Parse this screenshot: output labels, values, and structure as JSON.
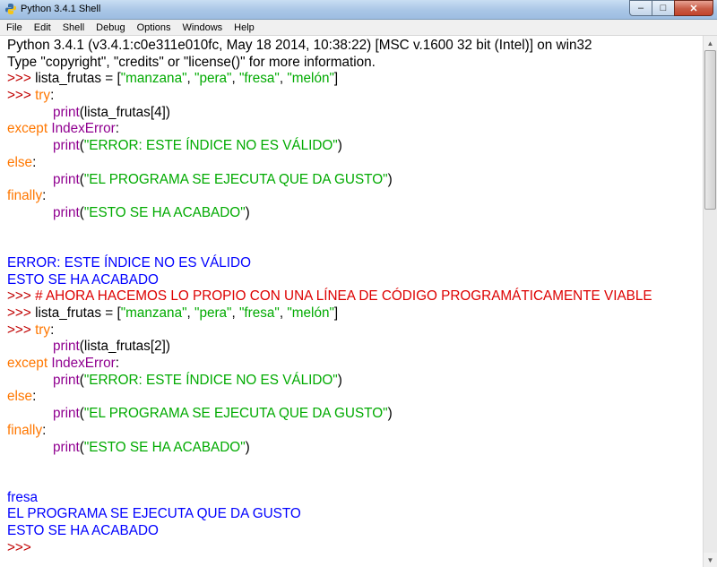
{
  "window": {
    "title": "Python 3.4.1 Shell"
  },
  "menubar": [
    "File",
    "Edit",
    "Shell",
    "Debug",
    "Options",
    "Windows",
    "Help"
  ],
  "window_controls": {
    "minimize_icon": "minimize-icon",
    "maximize_icon": "maximize-icon",
    "close_icon": "close-icon"
  },
  "colors": {
    "prompt": "#c00000",
    "keyword": "#ff7700",
    "builtin": "#900090",
    "string": "#00aa00",
    "output": "#0000ff",
    "comment": "#dd0000"
  },
  "lines": [
    [
      {
        "t": "default",
        "v": "Python 3.4.1 (v3.4.1:c0e311e010fc, May 18 2014, 10:38:22) [MSC v.1600 32 bit (Intel)] on win32"
      }
    ],
    [
      {
        "t": "default",
        "v": "Type \"copyright\", \"credits\" or \"license()\" for more information."
      }
    ],
    [
      {
        "t": "prompt",
        "v": ">>> "
      },
      {
        "t": "default",
        "v": "lista_frutas = ["
      },
      {
        "t": "string",
        "v": "\"manzana\""
      },
      {
        "t": "default",
        "v": ", "
      },
      {
        "t": "string",
        "v": "\"pera\""
      },
      {
        "t": "default",
        "v": ", "
      },
      {
        "t": "string",
        "v": "\"fresa\""
      },
      {
        "t": "default",
        "v": ", "
      },
      {
        "t": "string",
        "v": "\"melón\""
      },
      {
        "t": "default",
        "v": "]"
      }
    ],
    [
      {
        "t": "prompt",
        "v": ">>> "
      },
      {
        "t": "keyword",
        "v": "try"
      },
      {
        "t": "default",
        "v": ":"
      }
    ],
    [
      {
        "t": "default",
        "v": "            "
      },
      {
        "t": "builtin",
        "v": "print"
      },
      {
        "t": "default",
        "v": "(lista_frutas[4])"
      }
    ],
    [
      {
        "t": "keyword",
        "v": "except"
      },
      {
        "t": "default",
        "v": " "
      },
      {
        "t": "builtin",
        "v": "IndexError"
      },
      {
        "t": "default",
        "v": ":"
      }
    ],
    [
      {
        "t": "default",
        "v": "            "
      },
      {
        "t": "builtin",
        "v": "print"
      },
      {
        "t": "default",
        "v": "("
      },
      {
        "t": "string",
        "v": "\"ERROR: ESTE ÍNDICE NO ES VÁLIDO\""
      },
      {
        "t": "default",
        "v": ")"
      }
    ],
    [
      {
        "t": "keyword",
        "v": "else"
      },
      {
        "t": "default",
        "v": ":"
      }
    ],
    [
      {
        "t": "default",
        "v": "            "
      },
      {
        "t": "builtin",
        "v": "print"
      },
      {
        "t": "default",
        "v": "("
      },
      {
        "t": "string",
        "v": "\"EL PROGRAMA SE EJECUTA QUE DA GUSTO\""
      },
      {
        "t": "default",
        "v": ")"
      }
    ],
    [
      {
        "t": "keyword",
        "v": "finally"
      },
      {
        "t": "default",
        "v": ":"
      }
    ],
    [
      {
        "t": "default",
        "v": "            "
      },
      {
        "t": "builtin",
        "v": "print"
      },
      {
        "t": "default",
        "v": "("
      },
      {
        "t": "string",
        "v": "\"ESTO SE HA ACABADO\""
      },
      {
        "t": "default",
        "v": ")"
      }
    ],
    [],
    [],
    [
      {
        "t": "output",
        "v": "ERROR: ESTE ÍNDICE NO ES VÁLIDO"
      }
    ],
    [
      {
        "t": "output",
        "v": "ESTO SE HA ACABADO"
      }
    ],
    [
      {
        "t": "prompt",
        "v": ">>> "
      },
      {
        "t": "comment",
        "v": "# AHORA HACEMOS LO PROPIO CON UNA LÍNEA DE CÓDIGO PROGRAMÁTICAMENTE VIABLE"
      }
    ],
    [
      {
        "t": "prompt",
        "v": ">>> "
      },
      {
        "t": "default",
        "v": "lista_frutas = ["
      },
      {
        "t": "string",
        "v": "\"manzana\""
      },
      {
        "t": "default",
        "v": ", "
      },
      {
        "t": "string",
        "v": "\"pera\""
      },
      {
        "t": "default",
        "v": ", "
      },
      {
        "t": "string",
        "v": "\"fresa\""
      },
      {
        "t": "default",
        "v": ", "
      },
      {
        "t": "string",
        "v": "\"melón\""
      },
      {
        "t": "default",
        "v": "]"
      }
    ],
    [
      {
        "t": "prompt",
        "v": ">>> "
      },
      {
        "t": "keyword",
        "v": "try"
      },
      {
        "t": "default",
        "v": ":"
      }
    ],
    [
      {
        "t": "default",
        "v": "            "
      },
      {
        "t": "builtin",
        "v": "print"
      },
      {
        "t": "default",
        "v": "(lista_frutas[2])"
      }
    ],
    [
      {
        "t": "keyword",
        "v": "except"
      },
      {
        "t": "default",
        "v": " "
      },
      {
        "t": "builtin",
        "v": "IndexError"
      },
      {
        "t": "default",
        "v": ":"
      }
    ],
    [
      {
        "t": "default",
        "v": "            "
      },
      {
        "t": "builtin",
        "v": "print"
      },
      {
        "t": "default",
        "v": "("
      },
      {
        "t": "string",
        "v": "\"ERROR: ESTE ÍNDICE NO ES VÁLIDO\""
      },
      {
        "t": "default",
        "v": ")"
      }
    ],
    [
      {
        "t": "keyword",
        "v": "else"
      },
      {
        "t": "default",
        "v": ":"
      }
    ],
    [
      {
        "t": "default",
        "v": "            "
      },
      {
        "t": "builtin",
        "v": "print"
      },
      {
        "t": "default",
        "v": "("
      },
      {
        "t": "string",
        "v": "\"EL PROGRAMA SE EJECUTA QUE DA GUSTO\""
      },
      {
        "t": "default",
        "v": ")"
      }
    ],
    [
      {
        "t": "keyword",
        "v": "finally"
      },
      {
        "t": "default",
        "v": ":"
      }
    ],
    [
      {
        "t": "default",
        "v": "            "
      },
      {
        "t": "builtin",
        "v": "print"
      },
      {
        "t": "default",
        "v": "("
      },
      {
        "t": "string",
        "v": "\"ESTO SE HA ACABADO\""
      },
      {
        "t": "default",
        "v": ")"
      }
    ],
    [],
    [],
    [
      {
        "t": "output",
        "v": "fresa"
      }
    ],
    [
      {
        "t": "output",
        "v": "EL PROGRAMA SE EJECUTA QUE DA GUSTO"
      }
    ],
    [
      {
        "t": "output",
        "v": "ESTO SE HA ACABADO"
      }
    ],
    [
      {
        "t": "prompt",
        "v": ">>> "
      }
    ]
  ]
}
